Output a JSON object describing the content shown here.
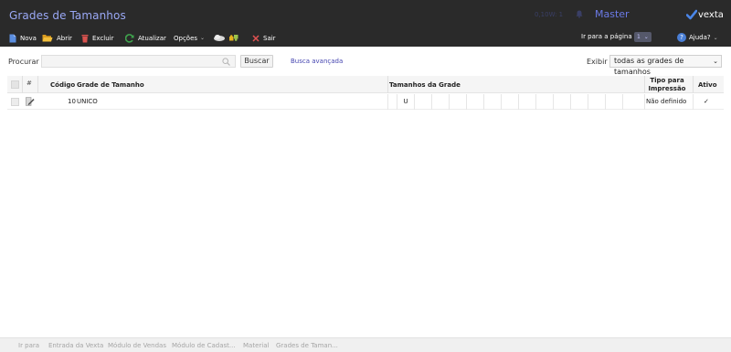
{
  "titlebar": {
    "title": "Grades de Tamanhos",
    "session": "0,10W: 1",
    "user": "Master",
    "logo_text": "vexta"
  },
  "toolbar": {
    "new_label": "Nova",
    "open_label": "Abrir",
    "delete_label": "Excluir",
    "refresh_label": "Atualizar",
    "options_label": "Opções",
    "exit_label": "Sair",
    "goto_label": "Ir para a página",
    "goto_value": "1",
    "help_label": "Ajuda?"
  },
  "search": {
    "label": "Procurar",
    "placeholder": "",
    "button_label": "Buscar",
    "advanced_label": "Busca avançada",
    "view_label": "Exibir",
    "view_value": "todas as grades de tamanhos"
  },
  "grid": {
    "columns": {
      "hash": "#",
      "code": "Código",
      "grade": "Grade de Tamanho",
      "sizes": "Tamanhos da Grade",
      "print_type_1": "Tipo para",
      "print_type_2": "Impressão",
      "active": "Ativo"
    },
    "rows": [
      {
        "code": "10",
        "grade": "UNICO",
        "sizes": [
          "U",
          "",
          "",
          "",
          "",
          "",
          "",
          "",
          "",
          "",
          "",
          "",
          "",
          "",
          ""
        ],
        "print_type": "Não definido",
        "active": "✓"
      }
    ]
  },
  "footer": {
    "breadcrumbs": [
      "Ir para",
      "Entrada da Vexta",
      "Módulo de Vendas",
      "Módulo de Cadast...",
      "Material",
      "Grades de Taman..."
    ]
  }
}
